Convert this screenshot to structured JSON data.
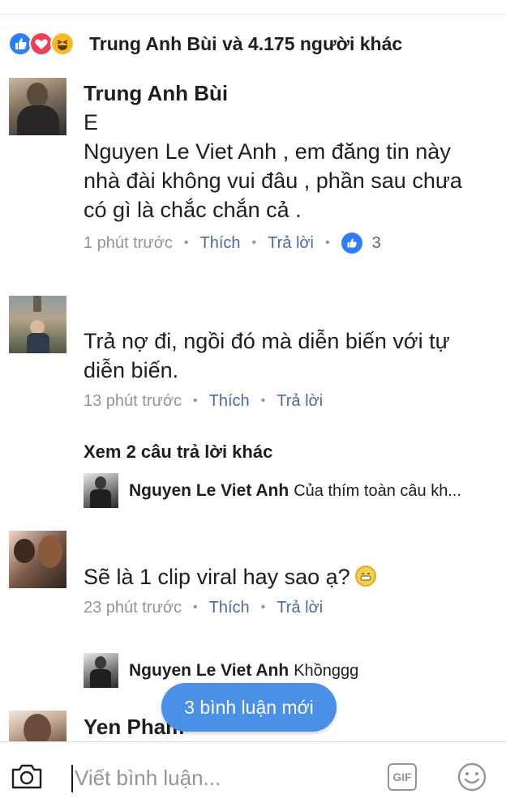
{
  "reactions": {
    "summary": "Trung Anh Bùi và 4.175 người khác",
    "icons": [
      "like-icon",
      "love-icon",
      "haha-icon"
    ],
    "colors": {
      "like": "#2d7ff9",
      "love": "#f33e58",
      "haha": "#f7b928"
    }
  },
  "comments": [
    {
      "name": "Trung Anh Bùi",
      "lines": [
        "E",
        "Nguyen Le Viet Anh , em đăng tin này",
        "nhà đài không vui đâu , phần sau chưa",
        "có gì là chắc chắn cả ."
      ],
      "time": "1 phút trước",
      "like_label": "Thích",
      "reply_label": "Trả lời",
      "like_count": "3"
    },
    {
      "lines": [
        "Trả nợ đi, ngồi đó mà diễn biến với tự",
        "diễn biến."
      ],
      "time": "13 phút trước",
      "like_label": "Thích",
      "reply_label": "Trả lời"
    },
    {
      "lines": [
        "Sẽ là 1 clip viral hay sao ạ?"
      ],
      "time": "23 phút trước",
      "like_label": "Thích",
      "reply_label": "Trả lời"
    },
    {
      "name": "Yen Pham"
    }
  ],
  "more_replies": "Xem 2 câu trả lời khác",
  "replies": [
    {
      "name": "Nguyen Le Viet Anh",
      "text": "Của thím toàn câu kh..."
    },
    {
      "name": "Nguyen Le Viet Anh",
      "text": "Khồnggg"
    }
  ],
  "new_comments_pill": "3 bình luận mới",
  "composer": {
    "placeholder": "Viết bình luận...",
    "gif_label": "GIF"
  },
  "colors": {
    "accent": "#4a90e8",
    "link": "#4b6aa1",
    "meta": "#90949c"
  }
}
